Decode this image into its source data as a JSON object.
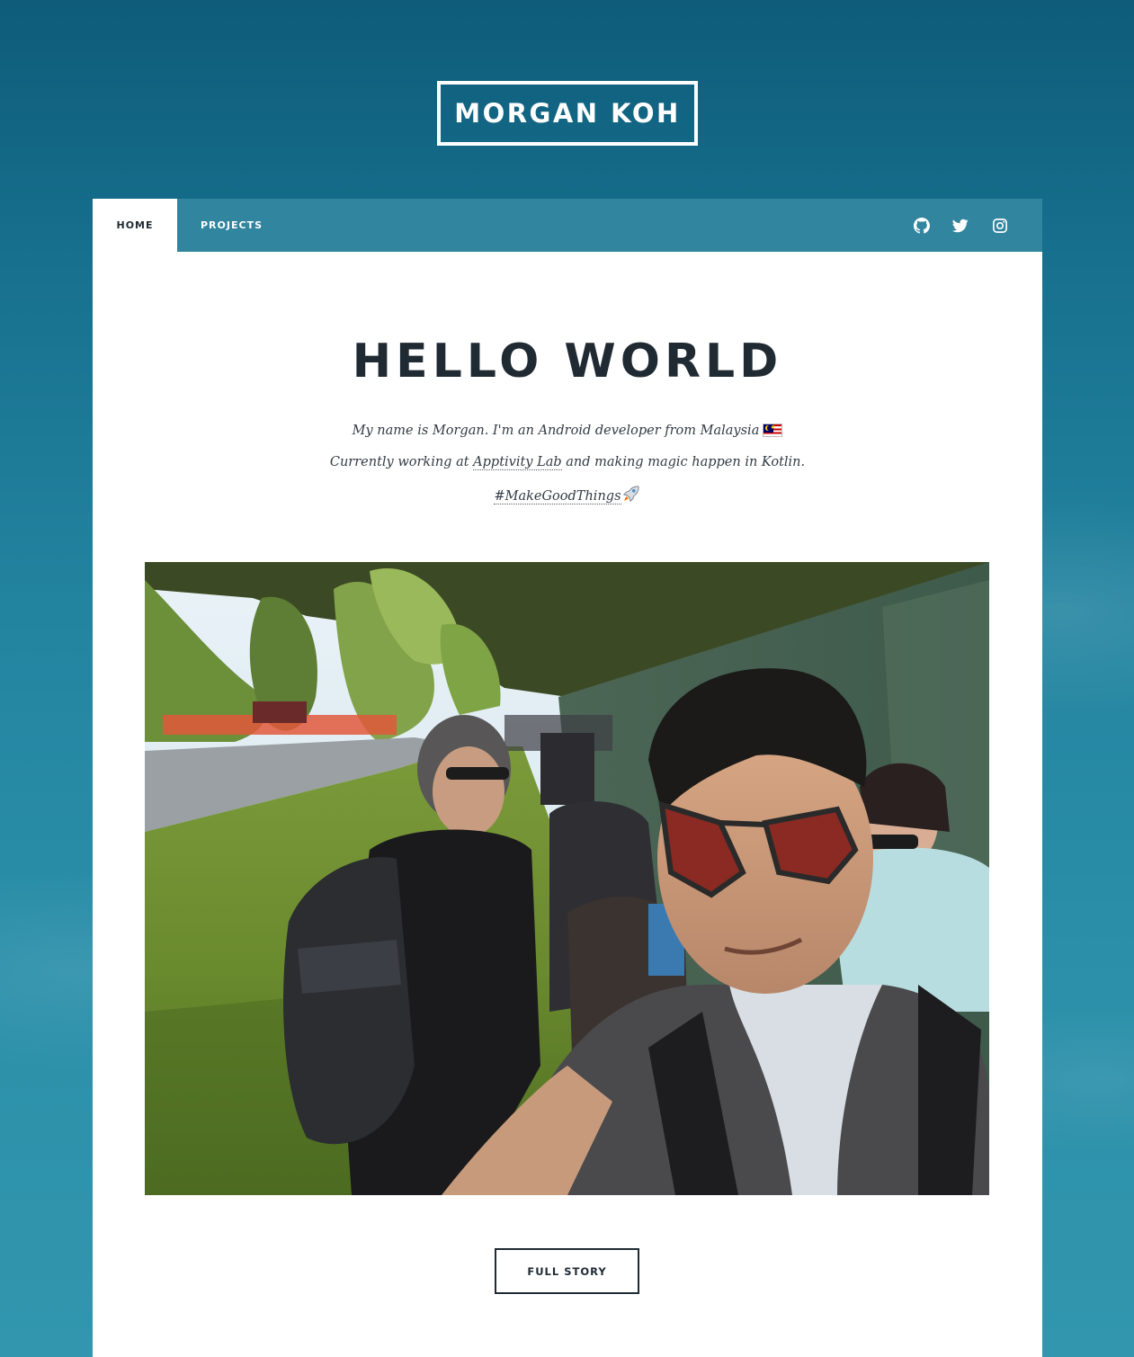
{
  "site": {
    "title": "MORGAN KOH"
  },
  "nav": {
    "tabs": [
      {
        "label": "HOME",
        "active": true
      },
      {
        "label": "PROJECTS",
        "active": false
      }
    ],
    "social_icons": [
      "github-icon",
      "twitter-icon",
      "instagram-icon"
    ],
    "background_color": "#31859f"
  },
  "main": {
    "headline": "HELLO WORLD",
    "intro": {
      "line1": "My name is Morgan. I'm an Android developer from Malaysia",
      "line1_emoji": "malaysia-flag-emoji",
      "line2_before": "Currently working at ",
      "line2_link": "Apptivity Lab",
      "line2_after": " and making magic happen in Kotlin.",
      "hashtag": "#MakeGoodThings",
      "hashtag_emoji": "rocket-emoji"
    },
    "photo": {
      "subject": "selfie-in-queue-outdoors"
    },
    "cta_label": "FULL STORY"
  },
  "colors": {
    "page_background_top": "#0e5c79",
    "page_background_bottom": "#3196ae",
    "text_dark": "#1f2a33",
    "card_background": "#ffffff"
  }
}
